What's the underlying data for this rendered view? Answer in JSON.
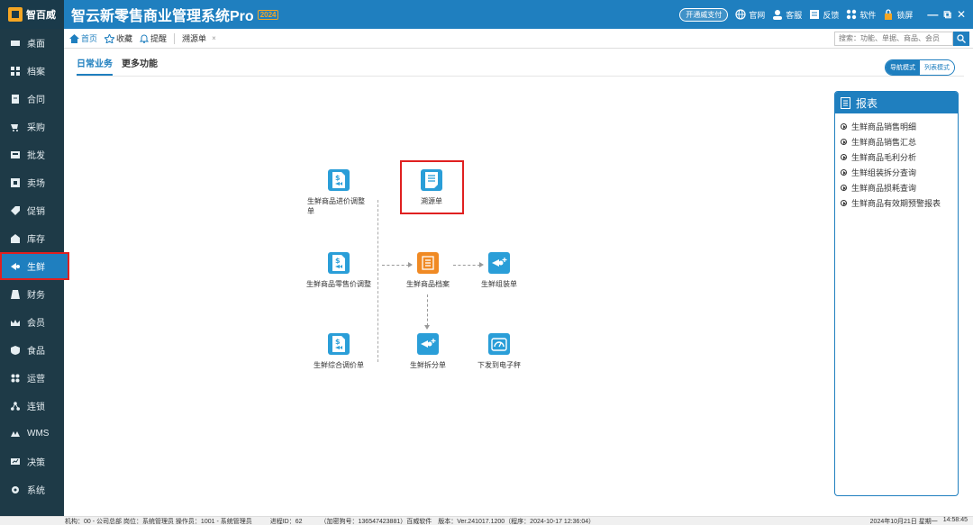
{
  "app": {
    "logo_text": "智百威",
    "title": "智云新零售商业管理系统Pro",
    "year_badge": "2024"
  },
  "top_actions": {
    "pay_label": "开通威支付",
    "links": [
      {
        "label": "官网",
        "icon": "globe-icon"
      },
      {
        "label": "客服",
        "icon": "support-icon"
      },
      {
        "label": "反馈",
        "icon": "feedback-icon"
      },
      {
        "label": "软件",
        "icon": "apps-icon"
      },
      {
        "label": "锁屏",
        "icon": "lock-icon"
      }
    ],
    "window_controls": [
      "—",
      "⧉",
      "✕"
    ]
  },
  "sidebar": {
    "items": [
      {
        "label": "桌面",
        "icon": "desktop-icon"
      },
      {
        "label": "档案",
        "icon": "archive-icon"
      },
      {
        "label": "合同",
        "icon": "contract-icon"
      },
      {
        "label": "采购",
        "icon": "purchase-icon"
      },
      {
        "label": "批发",
        "icon": "wholesale-icon"
      },
      {
        "label": "卖场",
        "icon": "store-icon"
      },
      {
        "label": "促销",
        "icon": "promotion-icon"
      },
      {
        "label": "库存",
        "icon": "inventory-icon"
      },
      {
        "label": "生鲜",
        "icon": "fresh-icon",
        "active": true
      },
      {
        "label": "财务",
        "icon": "finance-icon"
      },
      {
        "label": "会员",
        "icon": "member-icon"
      },
      {
        "label": "食品",
        "icon": "food-icon"
      },
      {
        "label": "运营",
        "icon": "operation-icon"
      },
      {
        "label": "连锁",
        "icon": "chain-icon"
      },
      {
        "label": "WMS",
        "icon": "wms-icon"
      },
      {
        "label": "决策",
        "icon": "decision-icon"
      },
      {
        "label": "系统",
        "icon": "system-icon"
      }
    ]
  },
  "tabs": {
    "home": "首页",
    "favorite": "收藏",
    "remind": "提醒",
    "current": "溯源单",
    "close": "×"
  },
  "search": {
    "placeholder": "搜索：功能、单据、商品、会员"
  },
  "subtabs": {
    "daily": "日常业务",
    "more": "更多功能"
  },
  "mode": {
    "nav": "导航模式",
    "list": "列表模式"
  },
  "diagram": {
    "nodes": {
      "purchase_price_adjust": "生鲜商品进价调整单",
      "trace": "溯源单",
      "retail_price_adjust": "生鲜商品零售价调整",
      "goods_archive": "生鲜商品档案",
      "assembly": "生鲜组装单",
      "combined_price": "生鲜综合调价单",
      "split": "生鲜拆分单",
      "scale": "下发到电子秤"
    }
  },
  "report": {
    "title": "报表",
    "items": [
      "生鲜商品销售明细",
      "生鲜商品销售汇总",
      "生鲜商品毛利分析",
      "生鲜组装拆分查询",
      "生鲜商品损耗查询",
      "生鲜商品有效期预警报表"
    ]
  },
  "status": {
    "org": "机构：00 - 公司总部",
    "post": "岗位：系统管理员",
    "operator": "操作员：1001 - 系统管理员",
    "process": "进程ID：62",
    "info": "（加密狗号：136547423881）百威软件　版本：Ver.241017.1200（程序：2024-10-17 12:36:04）",
    "date": "2024年10月21日 星期一",
    "time": "14:58:45"
  },
  "colors": {
    "brand": "#1f7fbf",
    "sidebar": "#1e3a47",
    "icon_blue": "#2a9ed8",
    "icon_orange": "#f08a24",
    "highlight": "#e02020"
  }
}
